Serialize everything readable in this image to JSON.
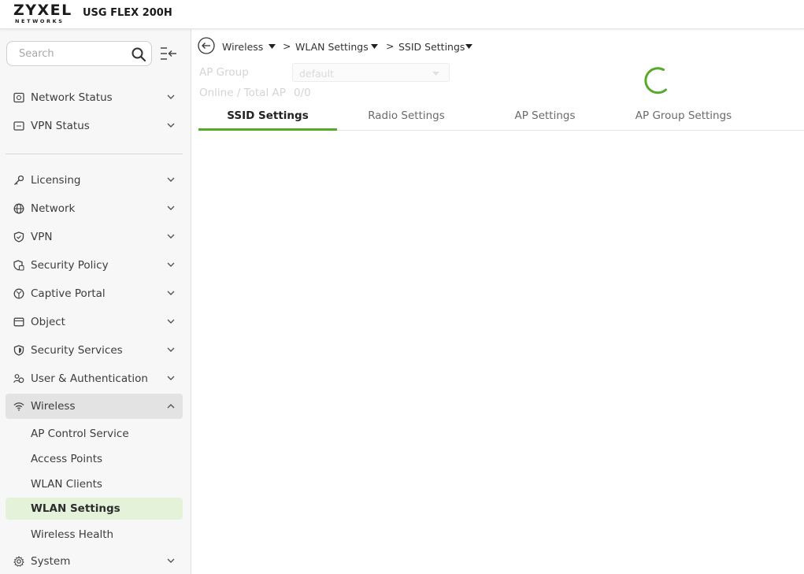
{
  "header": {
    "brand": "ZYXEL",
    "brand_sub": "NETWORKS",
    "model": "USG FLEX 200H"
  },
  "sidebar": {
    "search_placeholder": "Search",
    "groups_top": [
      {
        "label": "Network Status",
        "icon": "network-status-icon"
      },
      {
        "label": "VPN Status",
        "icon": "vpn-status-icon"
      }
    ],
    "items": [
      {
        "label": "Licensing",
        "icon": "key-icon"
      },
      {
        "label": "Network",
        "icon": "globe-icon"
      },
      {
        "label": "VPN",
        "icon": "shield-check-icon"
      },
      {
        "label": "Security Policy",
        "icon": "security-policy-icon"
      },
      {
        "label": "Captive Portal",
        "icon": "captive-portal-icon"
      },
      {
        "label": "Object",
        "icon": "object-icon"
      },
      {
        "label": "Security Services",
        "icon": "security-services-icon"
      },
      {
        "label": "User & Authentication",
        "icon": "users-icon"
      },
      {
        "label": "Wireless",
        "icon": "wifi-icon"
      }
    ],
    "wireless_sub": [
      {
        "label": "AP Control Service"
      },
      {
        "label": "Access Points"
      },
      {
        "label": "WLAN Clients"
      },
      {
        "label": "WLAN Settings"
      },
      {
        "label": "Wireless Health"
      }
    ],
    "system": {
      "label": "System",
      "icon": "gear-icon"
    },
    "selected_sub": "WLAN Settings",
    "expanded_group": "Wireless"
  },
  "breadcrumb": {
    "items": [
      "Wireless",
      "WLAN Settings",
      "SSID Settings"
    ],
    "separator": ">"
  },
  "form": {
    "ap_group_label": "AP Group",
    "ap_group_value": "default",
    "online_total_label": "Online / Total AP",
    "online_total_value": "0/0"
  },
  "tabs": [
    {
      "label": "SSID Settings",
      "active": true
    },
    {
      "label": "Radio Settings",
      "active": false
    },
    {
      "label": "AP Settings",
      "active": false
    },
    {
      "label": "AP Group Settings",
      "active": false
    }
  ],
  "colors": {
    "accent": "#55aa2c",
    "selected_bg": "#e4f2da",
    "active_group_bg": "#e3e3e3",
    "spinner": "#55aa2c"
  }
}
